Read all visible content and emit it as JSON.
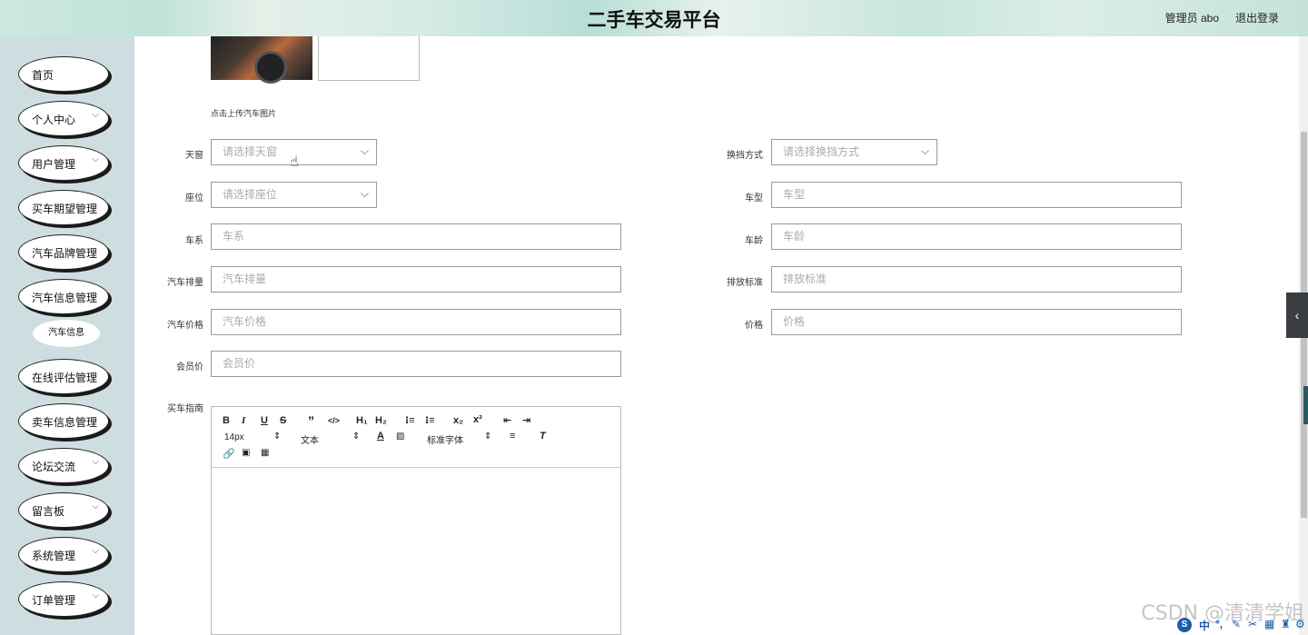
{
  "header": {
    "title": "二手车交易平台",
    "user": "管理员 abo",
    "logout": "退出登录"
  },
  "sidebar": {
    "items": [
      {
        "label": "首页",
        "chevron": false
      },
      {
        "label": "个人中心",
        "chevron": true
      },
      {
        "label": "用户管理",
        "chevron": true
      },
      {
        "label": "买车期望管理",
        "chevron": false
      },
      {
        "label": "汽车品牌管理",
        "chevron": false
      },
      {
        "label": "汽车信息管理",
        "chevron": false
      },
      {
        "label": "在线评估管理",
        "chevron": false
      },
      {
        "label": "卖车信息管理",
        "chevron": false
      },
      {
        "label": "论坛交流",
        "chevron": true
      },
      {
        "label": "留言板",
        "chevron": true
      },
      {
        "label": "系统管理",
        "chevron": true
      },
      {
        "label": "订单管理",
        "chevron": true
      }
    ],
    "submenu": "汽车信息"
  },
  "form": {
    "upload_hint": "点击上传汽车图片",
    "fields": {
      "sunroof": {
        "label": "天窗",
        "placeholder": "请选择天窗"
      },
      "transmission": {
        "label": "换挡方式",
        "placeholder": "请选择换挡方式"
      },
      "seats": {
        "label": "座位",
        "placeholder": "请选择座位"
      },
      "model": {
        "label": "车型",
        "placeholder": "车型"
      },
      "series": {
        "label": "车系",
        "placeholder": "车系"
      },
      "age": {
        "label": "车龄",
        "placeholder": "车龄"
      },
      "displacement": {
        "label": "汽车排量",
        "placeholder": "汽车排量"
      },
      "emission": {
        "label": "排放标准",
        "placeholder": "排放标准"
      },
      "car_price": {
        "label": "汽车价格",
        "placeholder": "汽车价格"
      },
      "price": {
        "label": "价格",
        "placeholder": "价格"
      },
      "member_price": {
        "label": "会员价",
        "placeholder": "会员价"
      },
      "guide": {
        "label": "买车指南"
      }
    },
    "editor": {
      "font_size": "14px",
      "text_type": "文本",
      "font_family": "标准字体"
    }
  },
  "watermark": "CSDN @清清学姐",
  "ime": "中"
}
